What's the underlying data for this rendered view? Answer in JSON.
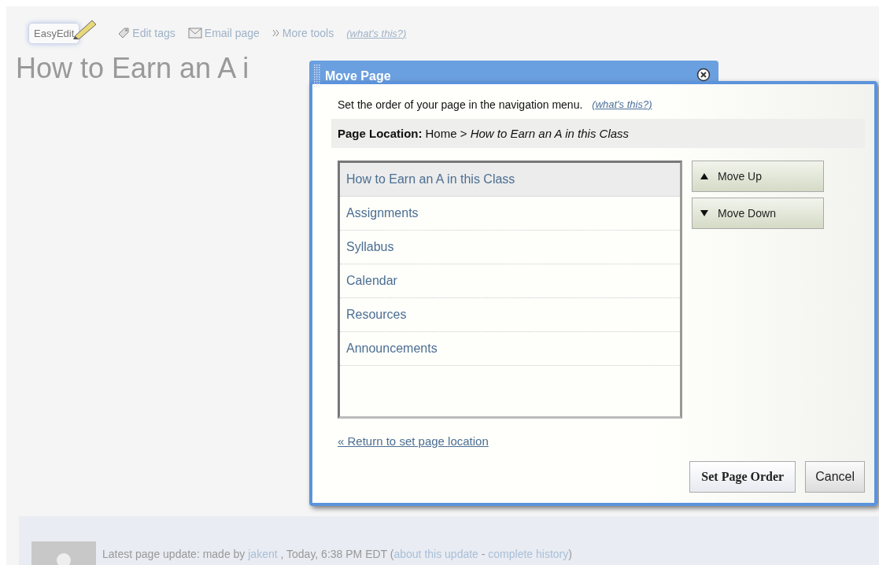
{
  "toolbar": {
    "easyedit": "EasyEdit",
    "links": [
      {
        "kind": "tag",
        "label": "Edit tags"
      },
      {
        "kind": "mail",
        "label": "Email page"
      },
      {
        "kind": "more",
        "label": "More tools"
      }
    ],
    "help": "(what's this?)"
  },
  "page_title": "How to Earn an A i",
  "dialog": {
    "title": "Move Page",
    "description": "Set the order of your page in the navigation menu.",
    "help": "(what's this?)",
    "location": {
      "label": "Page Location:",
      "text": "Home > *How to Earn an A in this Class*"
    },
    "pages": [
      {
        "label": "How to Earn an A in this Class",
        "selected": true
      },
      {
        "label": "Assignments",
        "selected": false
      },
      {
        "label": "Syllabus",
        "selected": false
      },
      {
        "label": "Calendar",
        "selected": false
      },
      {
        "label": "Resources",
        "selected": false
      },
      {
        "label": "Announcements",
        "selected": false
      }
    ],
    "move_up": "Move Up",
    "move_down": "Move Down",
    "return_link": "« Return to set page location",
    "confirm": "Set Page Order",
    "cancel": "Cancel"
  },
  "footer": {
    "prefix": "Latest page update: made by",
    "author": "jakent",
    "time": ", Today, 6:38 PM EDT (",
    "about": "about this update",
    "sep": " - ",
    "history": "complete history",
    "suffix": ")"
  }
}
